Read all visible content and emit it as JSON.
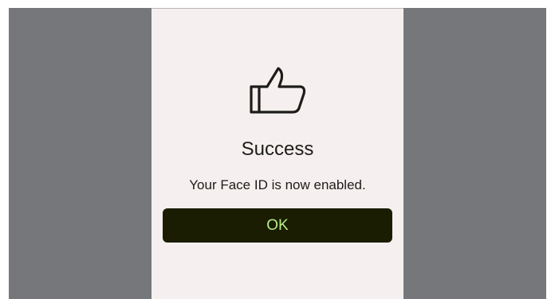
{
  "dialog": {
    "icon": "thumbs-up-icon",
    "title": "Success",
    "message": "Your Face ID is now enabled.",
    "ok_label": "OK"
  },
  "colors": {
    "backdrop": "#76777b",
    "sheet_background": "#f5f0ef",
    "button_background": "#1a1d02",
    "button_text": "#b9ec86",
    "text": "#1e1c18"
  }
}
